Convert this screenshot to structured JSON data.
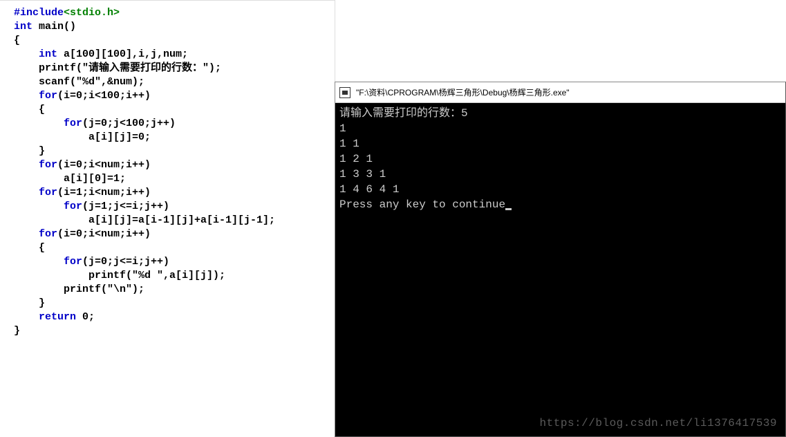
{
  "code": {
    "l1a": "#include",
    "l1b": "<stdio.h>",
    "l2a": "int",
    "l2b": " main()",
    "l3": "{",
    "l4a": "    ",
    "l4b": "int",
    "l4c": " a[100][100],i,j,num;",
    "l5a": "    printf(\"",
    "l5b": "请输入需要打印的行数：",
    "l5c": "\");",
    "l6": "    scanf(\"%d\",&num);",
    "l7a": "    ",
    "l7b": "for",
    "l7c": "(i=0;i<100;i++)",
    "l8": "    {",
    "l9a": "        ",
    "l9b": "for",
    "l9c": "(j=0;j<100;j++)",
    "l10": "            a[i][j]=0;",
    "l11": "    }",
    "l12a": "    ",
    "l12b": "for",
    "l12c": "(i=0;i<num;i++)",
    "l13": "        a[i][0]=1;",
    "l14a": "    ",
    "l14b": "for",
    "l14c": "(i=1;i<num;i++)",
    "l15a": "        ",
    "l15b": "for",
    "l15c": "(j=1;j<=i;j++)",
    "l16": "            a[i][j]=a[i-1][j]+a[i-1][j-1];",
    "l17a": "    ",
    "l17b": "for",
    "l17c": "(i=0;i<num;i++)",
    "l18": "    {",
    "l19a": "        ",
    "l19b": "for",
    "l19c": "(j=0;j<=i;j++)",
    "l20": "            printf(\"%d \",a[i][j]);",
    "l21": "        printf(\"\\n\");",
    "l22": "    }",
    "l23a": "    ",
    "l23b": "return",
    "l23c": " 0;",
    "l24": "}"
  },
  "console": {
    "title": "\"F:\\资料\\CPROGRAM\\杨辉三角形\\Debug\\杨辉三角形.exe\"",
    "line1": "请输入需要打印的行数：5",
    "line2": "1",
    "line3": "1 1",
    "line4": "1 2 1",
    "line5": "1 3 3 1",
    "line6": "1 4 6 4 1",
    "line7": "Press any key to continue"
  },
  "watermark": "https://blog.csdn.net/li1376417539"
}
